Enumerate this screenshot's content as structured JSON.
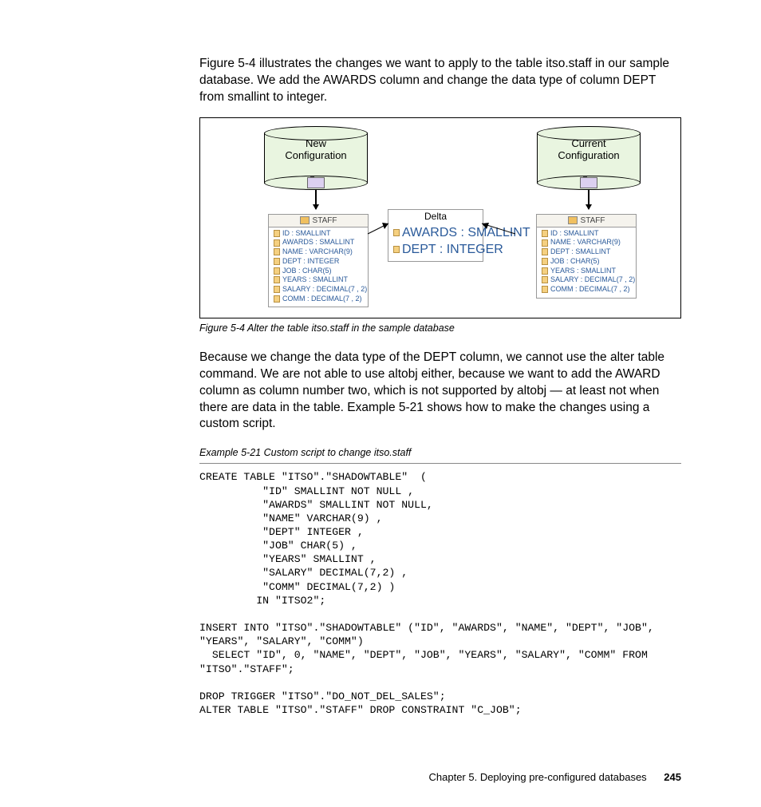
{
  "para1": "Figure 5-4 illustrates the changes we want to apply to the table itso.staff in our sample database. We add the AWARDS column and change the data type of column DEPT from smallint to integer.",
  "figure": {
    "newConfig": "New\nConfiguration",
    "currentConfig": "Current\nConfiguration",
    "deltaTitle": "Delta",
    "staffHeader": "STAFF",
    "newCols": [
      "ID : SMALLINT",
      "AWARDS : SMALLINT",
      "NAME : VARCHAR(9)",
      "DEPT : INTEGER",
      "JOB : CHAR(5)",
      "YEARS : SMALLINT",
      "SALARY : DECIMAL(7 , 2)",
      "COMM : DECIMAL(7 , 2)"
    ],
    "deltaCols": [
      "AWARDS : SMALLINT",
      "DEPT : INTEGER"
    ],
    "curCols": [
      "ID : SMALLINT",
      "NAME : VARCHAR(9)",
      "DEPT : SMALLINT",
      "JOB : CHAR(5)",
      "YEARS : SMALLINT",
      "SALARY : DECIMAL(7 , 2)",
      "COMM : DECIMAL(7 , 2)"
    ],
    "caption": "Figure 5-4   Alter the table itso.staff in the sample database"
  },
  "para2": "Because we change the data type of the DEPT column, we cannot use the alter table command. We are not able to use altobj either, because we want to add the AWARD column as column number two, which is not supported by altobj — at least not when there are data in the table. Example 5-21 shows how to make the changes using a custom script.",
  "exampleCaption": "Example 5-21   Custom script to change itso.staff",
  "code": "CREATE TABLE \"ITSO\".\"SHADOWTABLE\"  (\n          \"ID\" SMALLINT NOT NULL , \n          \"AWARDS\" SMALLINT NOT NULL,\n          \"NAME\" VARCHAR(9) , \n          \"DEPT\" INTEGER , \n          \"JOB\" CHAR(5) , \n          \"YEARS\" SMALLINT , \n          \"SALARY\" DECIMAL(7,2) , \n          \"COMM\" DECIMAL(7,2) )   \n         IN \"ITSO2\"; \n\nINSERT INTO \"ITSO\".\"SHADOWTABLE\" (\"ID\", \"AWARDS\", \"NAME\", \"DEPT\", \"JOB\", \n\"YEARS\", \"SALARY\", \"COMM\")\n  SELECT \"ID\", 0, \"NAME\", \"DEPT\", \"JOB\", \"YEARS\", \"SALARY\", \"COMM\" FROM \n\"ITSO\".\"STAFF\";\n\nDROP TRIGGER \"ITSO\".\"DO_NOT_DEL_SALES\";\nALTER TABLE \"ITSO\".\"STAFF\" DROP CONSTRAINT \"C_JOB\";",
  "footer": {
    "chapter": "Chapter 5. Deploying pre-configured databases",
    "page": "245"
  }
}
